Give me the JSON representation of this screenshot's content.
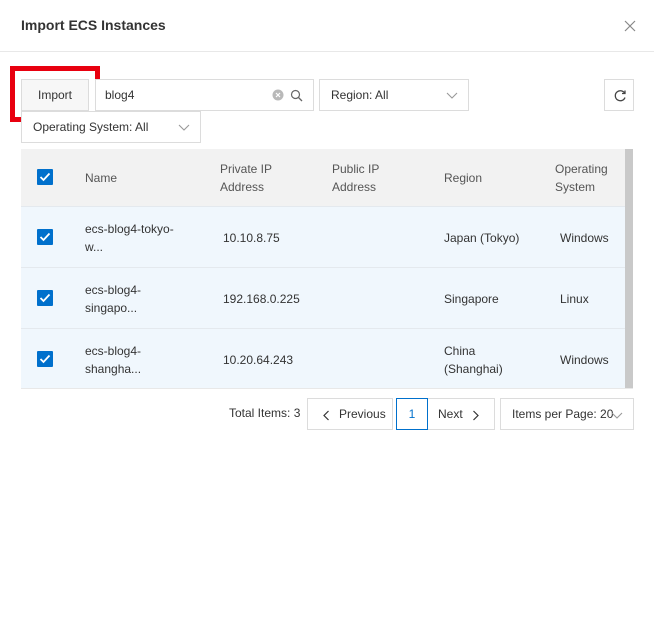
{
  "dialog": {
    "title": "Import ECS Instances"
  },
  "toolbar": {
    "import_label": "Import",
    "search_value": "blog4",
    "region_select": "Region: All",
    "os_select": "Operating System: All"
  },
  "table": {
    "headers": {
      "name": "Name",
      "private_ip_1": "Private IP",
      "private_ip_2": "Address",
      "public_ip_1": "Public IP",
      "public_ip_2": "Address",
      "region": "Region",
      "os_1": "Operating",
      "os_2": "System"
    },
    "rows": [
      {
        "name_1": "ecs-blog4-tokyo-",
        "name_2": "w...",
        "private_ip": "10.10.8.75",
        "public_ip": "",
        "region_1": "Japan (Tokyo)",
        "region_2": "",
        "os": "Windows",
        "checked": true
      },
      {
        "name_1": "ecs-blog4-",
        "name_2": "singapo...",
        "private_ip": "192.168.0.225",
        "public_ip": "",
        "region_1": "Singapore",
        "region_2": "",
        "os": "Linux",
        "checked": true
      },
      {
        "name_1": "ecs-blog4-",
        "name_2": "shangha...",
        "private_ip": "10.20.64.243",
        "public_ip": "",
        "region_1": "China",
        "region_2": "(Shanghai)",
        "os": "Windows",
        "checked": true
      }
    ]
  },
  "pagination": {
    "total": "Total Items: 3",
    "previous": "Previous",
    "current_page": "1",
    "next": "Next",
    "items_per_page": "Items per Page: 20"
  },
  "colors": {
    "accent": "#0070cc",
    "highlight": "#e8000f",
    "row_bg": "#f0f7fd",
    "header_bg": "#f2f2f2"
  }
}
